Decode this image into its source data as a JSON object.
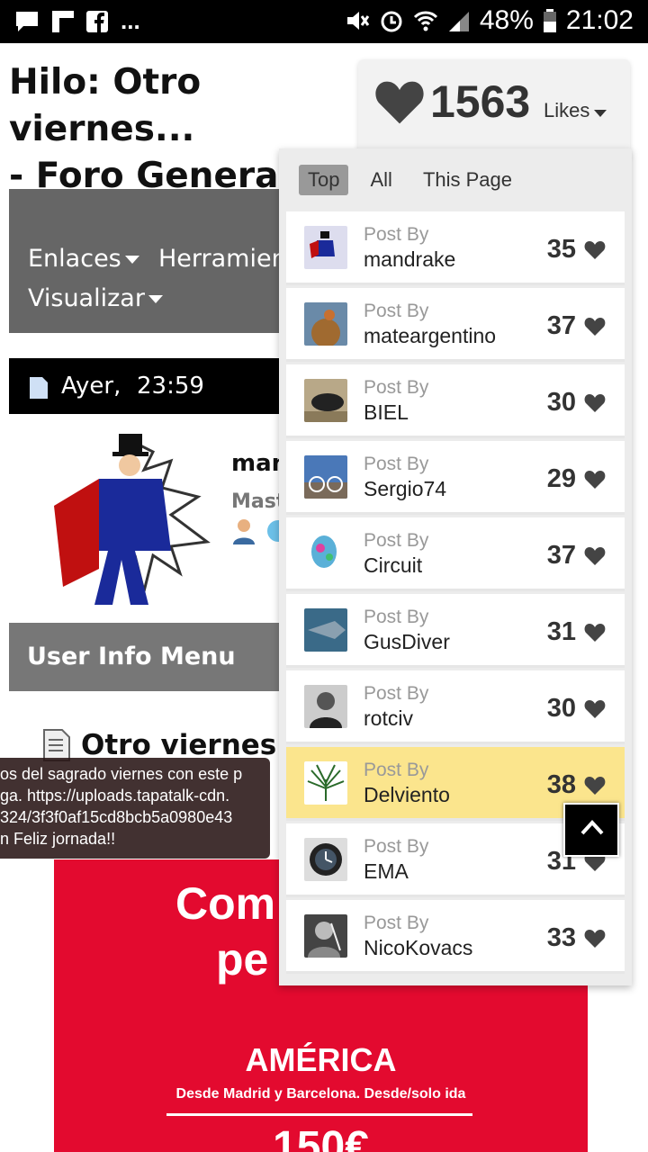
{
  "status_bar": {
    "battery": "48%",
    "time": "21:02",
    "dots": "..."
  },
  "page": {
    "title_line1": "Hilo: Otro viernes...",
    "title_line2": "- Foro General",
    "nav": {
      "enlaces": "Enlaces",
      "herramientas": "Herramient",
      "visualizar": "Visualizar"
    },
    "post_date": "Ayer,",
    "post_time": "23:59",
    "author_name": "man",
    "author_rank": "Mast",
    "user_info_menu": "User Info Menu",
    "post_title": "Otro viernes...",
    "tooltip_lines": [
      "os del sagrado viernes con este p",
      "ga. https://uploads.tapatalk-cdn.",
      "324/3f3f0af15cd8bcb5a0980e43",
      "n Feliz jornada!!"
    ],
    "ad": {
      "line1": "Com",
      "line2": "pe",
      "region": "AMÉRICA",
      "sub": "Desde Madrid y Barcelona. Desde/solo ida",
      "price": "150€"
    }
  },
  "likes": {
    "total": "1563",
    "label": "Likes",
    "tabs": [
      "Top",
      "All",
      "This Page"
    ],
    "active_tab": "Top",
    "post_by_label": "Post By",
    "rows": [
      {
        "user": "mandrake",
        "count": "35"
      },
      {
        "user": "mateargentino",
        "count": "37"
      },
      {
        "user": "BIEL",
        "count": "30"
      },
      {
        "user": "Sergio74",
        "count": "29"
      },
      {
        "user": "Circuit",
        "count": "37"
      },
      {
        "user": "GusDiver",
        "count": "31"
      },
      {
        "user": "rotciv",
        "count": "30"
      },
      {
        "user": "Delviento",
        "count": "38"
      },
      {
        "user": "EMA",
        "count": "31"
      },
      {
        "user": "NicoKovacs",
        "count": "33"
      }
    ],
    "highlight_color": "#fbe58d"
  }
}
